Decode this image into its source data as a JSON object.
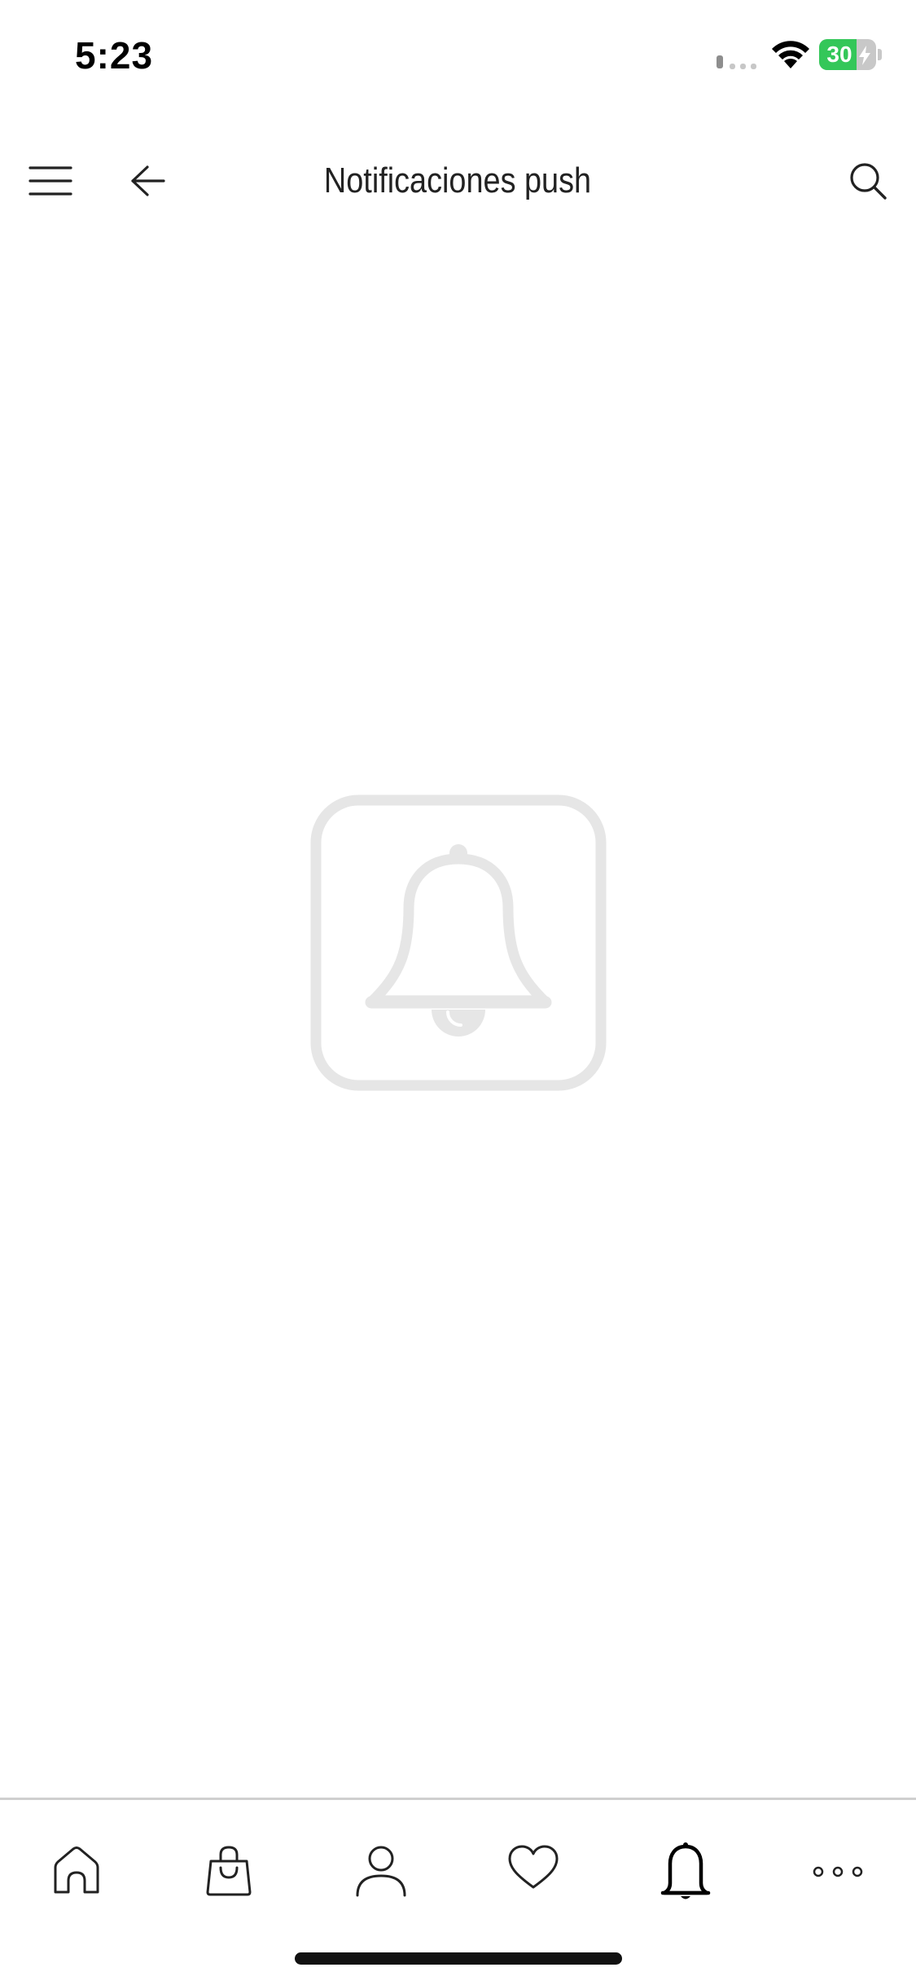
{
  "status_bar": {
    "time": "5:23",
    "battery_percent": "30",
    "battery_level": 0.3,
    "battery_fill_color": "#34c759",
    "charging": true
  },
  "header": {
    "title": "Notificaciones push",
    "menu_icon": "hamburger-menu-icon",
    "back_icon": "arrow-left-icon",
    "search_icon": "search-icon"
  },
  "main": {
    "empty_state_icon": "bell-in-rounded-square-icon",
    "empty_state_color": "#e6e6e6"
  },
  "tab_bar": {
    "tabs": [
      {
        "icon": "home-icon",
        "active": false
      },
      {
        "icon": "shopping-bag-icon",
        "active": false
      },
      {
        "icon": "user-icon",
        "active": false
      },
      {
        "icon": "heart-icon",
        "active": false
      },
      {
        "icon": "bell-icon",
        "active": true
      },
      {
        "icon": "more-dots-icon",
        "active": false
      }
    ]
  }
}
